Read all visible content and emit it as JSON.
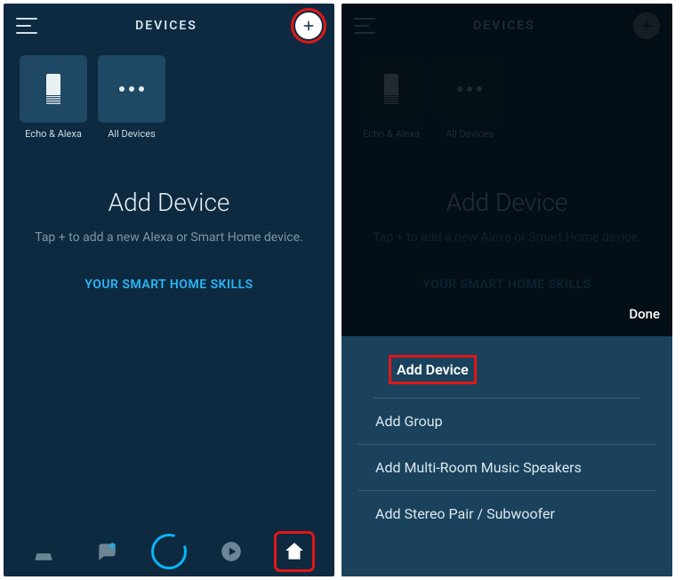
{
  "header": {
    "title": "DEVICES"
  },
  "tiles": {
    "echo_label": "Echo & Alexa",
    "all_label": "All Devices"
  },
  "main": {
    "heading": "Add Device",
    "subtext": "Tap + to add a new Alexa or Smart Home device.",
    "skills_link": "YOUR SMART HOME SKILLS"
  },
  "sheet": {
    "done": "Done",
    "items": [
      "Add Device",
      "Add Group",
      "Add Multi-Room Music Speakers",
      "Add Stereo Pair / Subwoofer"
    ]
  }
}
